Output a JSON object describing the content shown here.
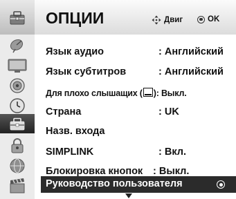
{
  "header": {
    "title": "ОПЦИИ",
    "move_hint": "Двиг",
    "ok_hint": "OK",
    "header_icon": "options-toolbox-icon"
  },
  "sidebar": {
    "icons": [
      {
        "name": "satellite-dish-icon",
        "active": false
      },
      {
        "name": "tv-picture-icon",
        "active": false
      },
      {
        "name": "speaker-audio-icon",
        "active": false
      },
      {
        "name": "clock-time-icon",
        "active": false
      },
      {
        "name": "options-toolbox-icon",
        "active": true
      },
      {
        "name": "lock-icon",
        "active": false
      },
      {
        "name": "network-globe-icon",
        "active": false
      },
      {
        "name": "film-clapper-icon",
        "active": false
      }
    ]
  },
  "menu": {
    "items": [
      {
        "label": "Язык аудио",
        "value": ": Английский"
      },
      {
        "label": "Язык субтитров",
        "value": ": Английский"
      },
      {
        "label_prefix": "Для плохо слышащих (",
        "label_suffix": "): Выкл.",
        "icon": "closed-caption-icon"
      },
      {
        "label": "Страна",
        "value": ": UK"
      },
      {
        "label": "Назв. входа",
        "value": ""
      },
      {
        "label": "SIMPLINK",
        "value": ": Вкл."
      },
      {
        "label": "Блокировка кнопок",
        "value": ": Выкл."
      },
      {
        "label": "Руководство пользователя",
        "selected": true
      }
    ],
    "more_indicator": "down-arrow-icon"
  }
}
